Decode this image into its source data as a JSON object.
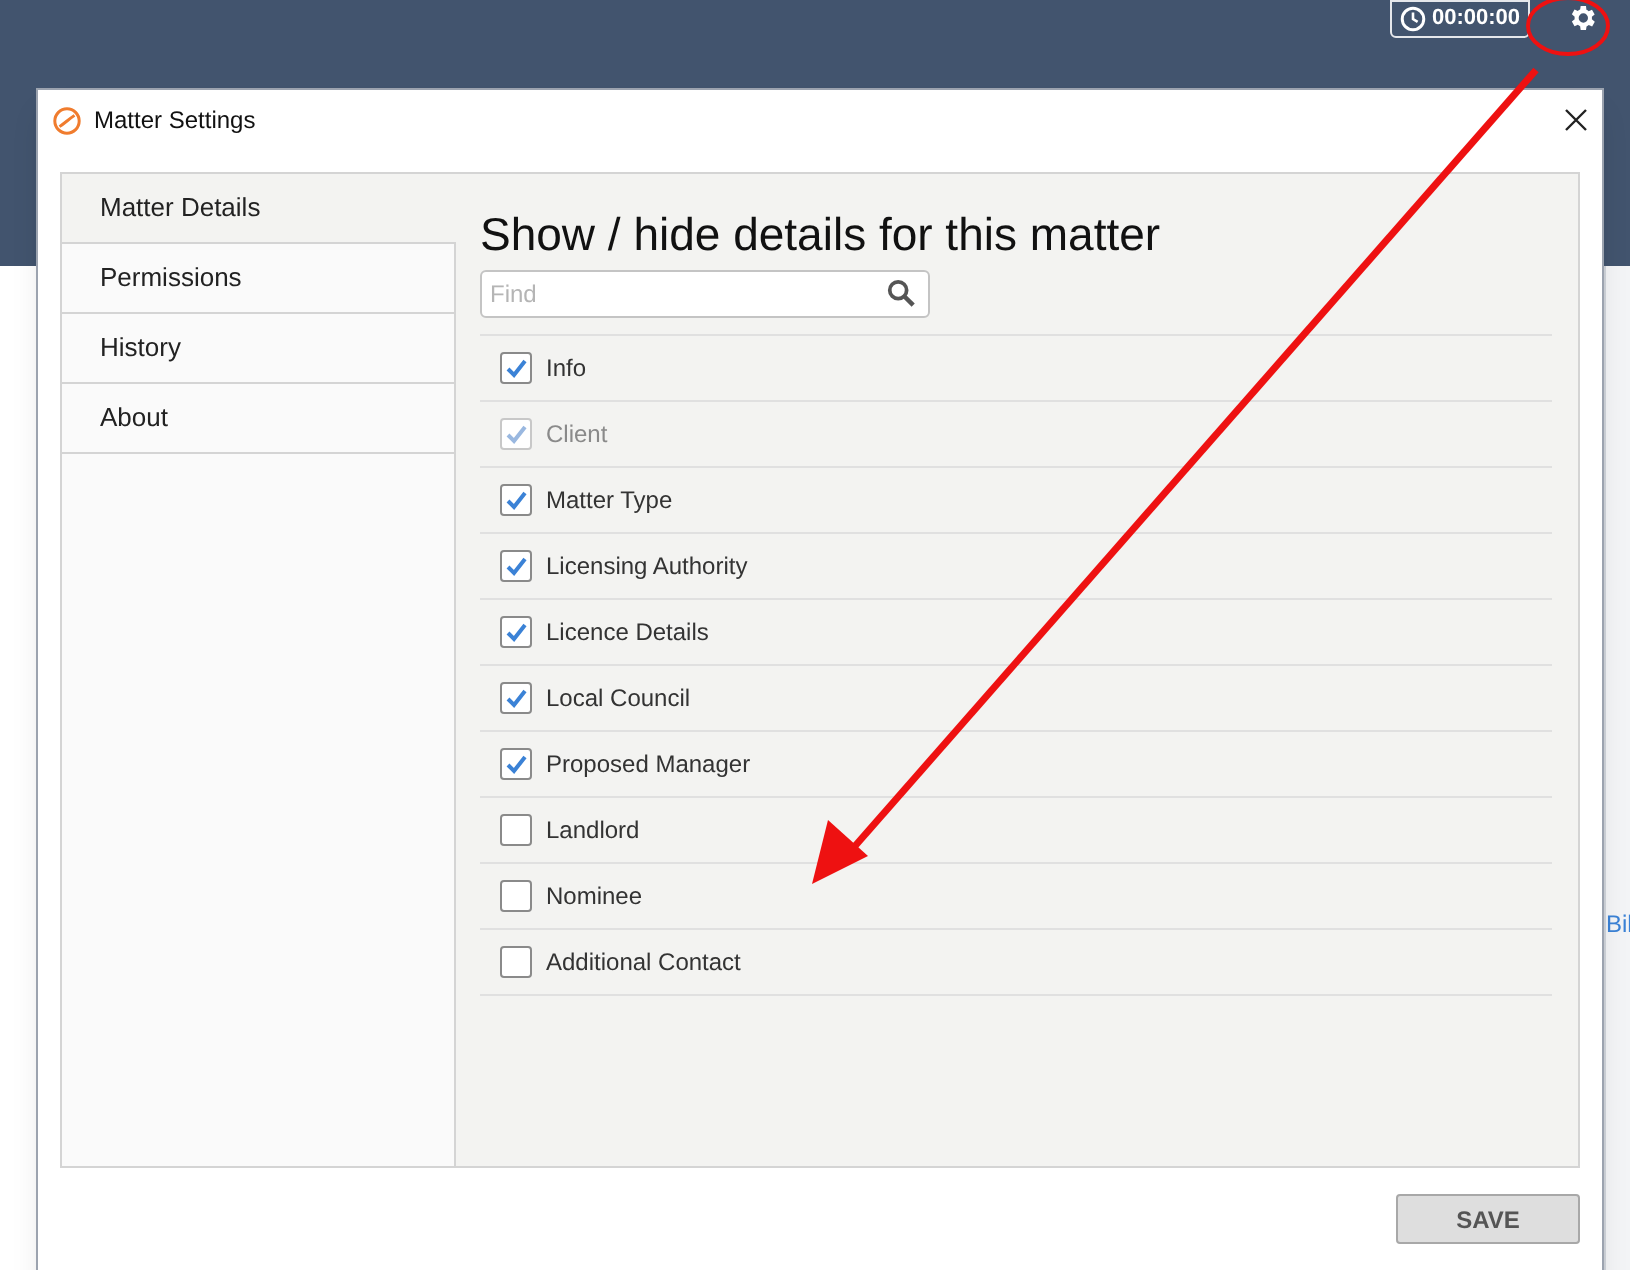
{
  "app": {
    "timer": "00:00:00",
    "side_link": "Bil"
  },
  "dialog": {
    "title": "Matter Settings",
    "nav": [
      {
        "label": "Matter Details",
        "selected": true
      },
      {
        "label": "Permissions",
        "selected": false
      },
      {
        "label": "History",
        "selected": false
      },
      {
        "label": "About",
        "selected": false
      }
    ],
    "heading": "Show / hide details for this matter",
    "search": {
      "placeholder": "Find"
    },
    "items": [
      {
        "label": "Info",
        "checked": true,
        "disabled": false
      },
      {
        "label": "Client",
        "checked": true,
        "disabled": true
      },
      {
        "label": "Matter Type",
        "checked": true,
        "disabled": false
      },
      {
        "label": "Licensing Authority",
        "checked": true,
        "disabled": false
      },
      {
        "label": "Licence Details",
        "checked": true,
        "disabled": false
      },
      {
        "label": "Local Council",
        "checked": true,
        "disabled": false
      },
      {
        "label": "Proposed Manager",
        "checked": true,
        "disabled": false
      },
      {
        "label": "Landlord",
        "checked": false,
        "disabled": false
      },
      {
        "label": "Nominee",
        "checked": false,
        "disabled": false
      },
      {
        "label": "Additional Contact",
        "checked": false,
        "disabled": false
      }
    ],
    "save": "SAVE"
  }
}
